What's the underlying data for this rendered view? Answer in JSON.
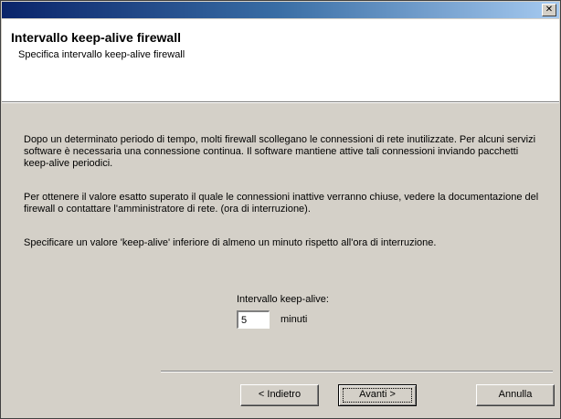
{
  "window": {
    "close_glyph": "✕"
  },
  "header": {
    "title": "Intervallo keep-alive firewall",
    "subtitle": "Specifica intervallo keep-alive firewall"
  },
  "body": {
    "paragraph1": "Dopo un determinato periodo di tempo, molti firewall scollegano le connessioni di rete inutilizzate.  Per alcuni servizi software è necessaria una connessione continua.  Il software mantiene attive tali connessioni inviando pacchetti keep-alive periodici.",
    "paragraph2": "Per ottenere il valore esatto superato il quale le connessioni inattive verranno chiuse, vedere la documentazione del firewall o contattare l'amministratore di rete. (ora di interruzione).",
    "paragraph3": "Specificare un valore 'keep-alive' inferiore di almeno un minuto rispetto all'ora di interruzione."
  },
  "keepalive": {
    "label": "Intervallo keep-alive:",
    "value": "5",
    "unit": "minuti"
  },
  "buttons": {
    "back": "< Indietro",
    "next": "Avanti >",
    "cancel": "Annulla"
  }
}
